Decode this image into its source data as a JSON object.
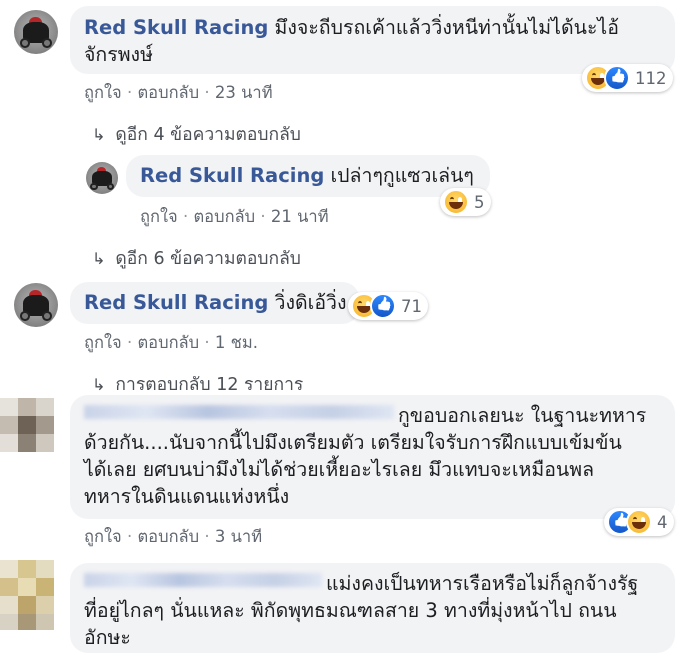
{
  "comments": [
    {
      "author": "Red Skull Racing",
      "text_line1": "มึงจะถีบรถเค้าแล้ววิ่งหนีท่านั้นไม่ได้นะไอ้",
      "text_line2": "จักรพงษ์",
      "like": "ถูกใจ",
      "reply": "ตอบกลับ",
      "time": "23 นาที",
      "reaction_count": "112",
      "reactions": [
        "haha-icon",
        "like-icon"
      ],
      "more_replies": "ดูอีก 4 ข้อความตอบกลับ"
    },
    {
      "author": "Red Skull Racing",
      "text": "เปล่าๆกูแซวเล่นๆ",
      "like": "ถูกใจ",
      "reply": "ตอบกลับ",
      "time": "21 นาที",
      "reaction_count": "5",
      "reactions": [
        "haha-icon"
      ],
      "more_replies": "ดูอีก 6 ข้อความตอบกลับ"
    },
    {
      "author": "Red Skull Racing",
      "text": "วิ่งดิเอ้วิ่ง",
      "like": "ถูกใจ",
      "reply": "ตอบกลับ",
      "time": "1 ชม.",
      "reaction_count": "71",
      "reactions": [
        "haha-icon",
        "like-icon"
      ],
      "more_replies": "การตอบกลับ 12 รายการ"
    },
    {
      "text_line1": "กูขอบอกเลยนะ ในฐานะทหาร",
      "text_line2": "ด้วยกัน....นับจากนี้ไปมึงเตรียมตัว เตรียมใจรับการฝึกแบบเข้มข้น",
      "text_line3": "ได้เลย ยศบนบ่ามึงไม่ได้ช่วยเหี้ยอะไรเลย มึวแทบจะเหมือนพล",
      "text_line4": "ทหารในดินแดนแห่งหนึ่ง",
      "like": "ถูกใจ",
      "reply": "ตอบกลับ",
      "time": "3 นาที",
      "reaction_count": "4",
      "reactions": [
        "like-icon",
        "haha-icon"
      ]
    },
    {
      "text_line1": "แม่งคงเป็นทหารเรือหรือไม่ก็ลูกจ้างรัฐ",
      "text_line2": "ที่อยู่ไกลๆ นั่นแหละ พิกัดพุทธมณฑลสาย 3 ทางที่มุ่งหน้าไป ถนน",
      "text_line3": "อักษะ"
    }
  ],
  "colors": {
    "author": "#385898",
    "bubble": "#f2f3f5",
    "meta": "#606770",
    "like_blue": "#1877f2",
    "haha_yellow": "#f7b125"
  }
}
